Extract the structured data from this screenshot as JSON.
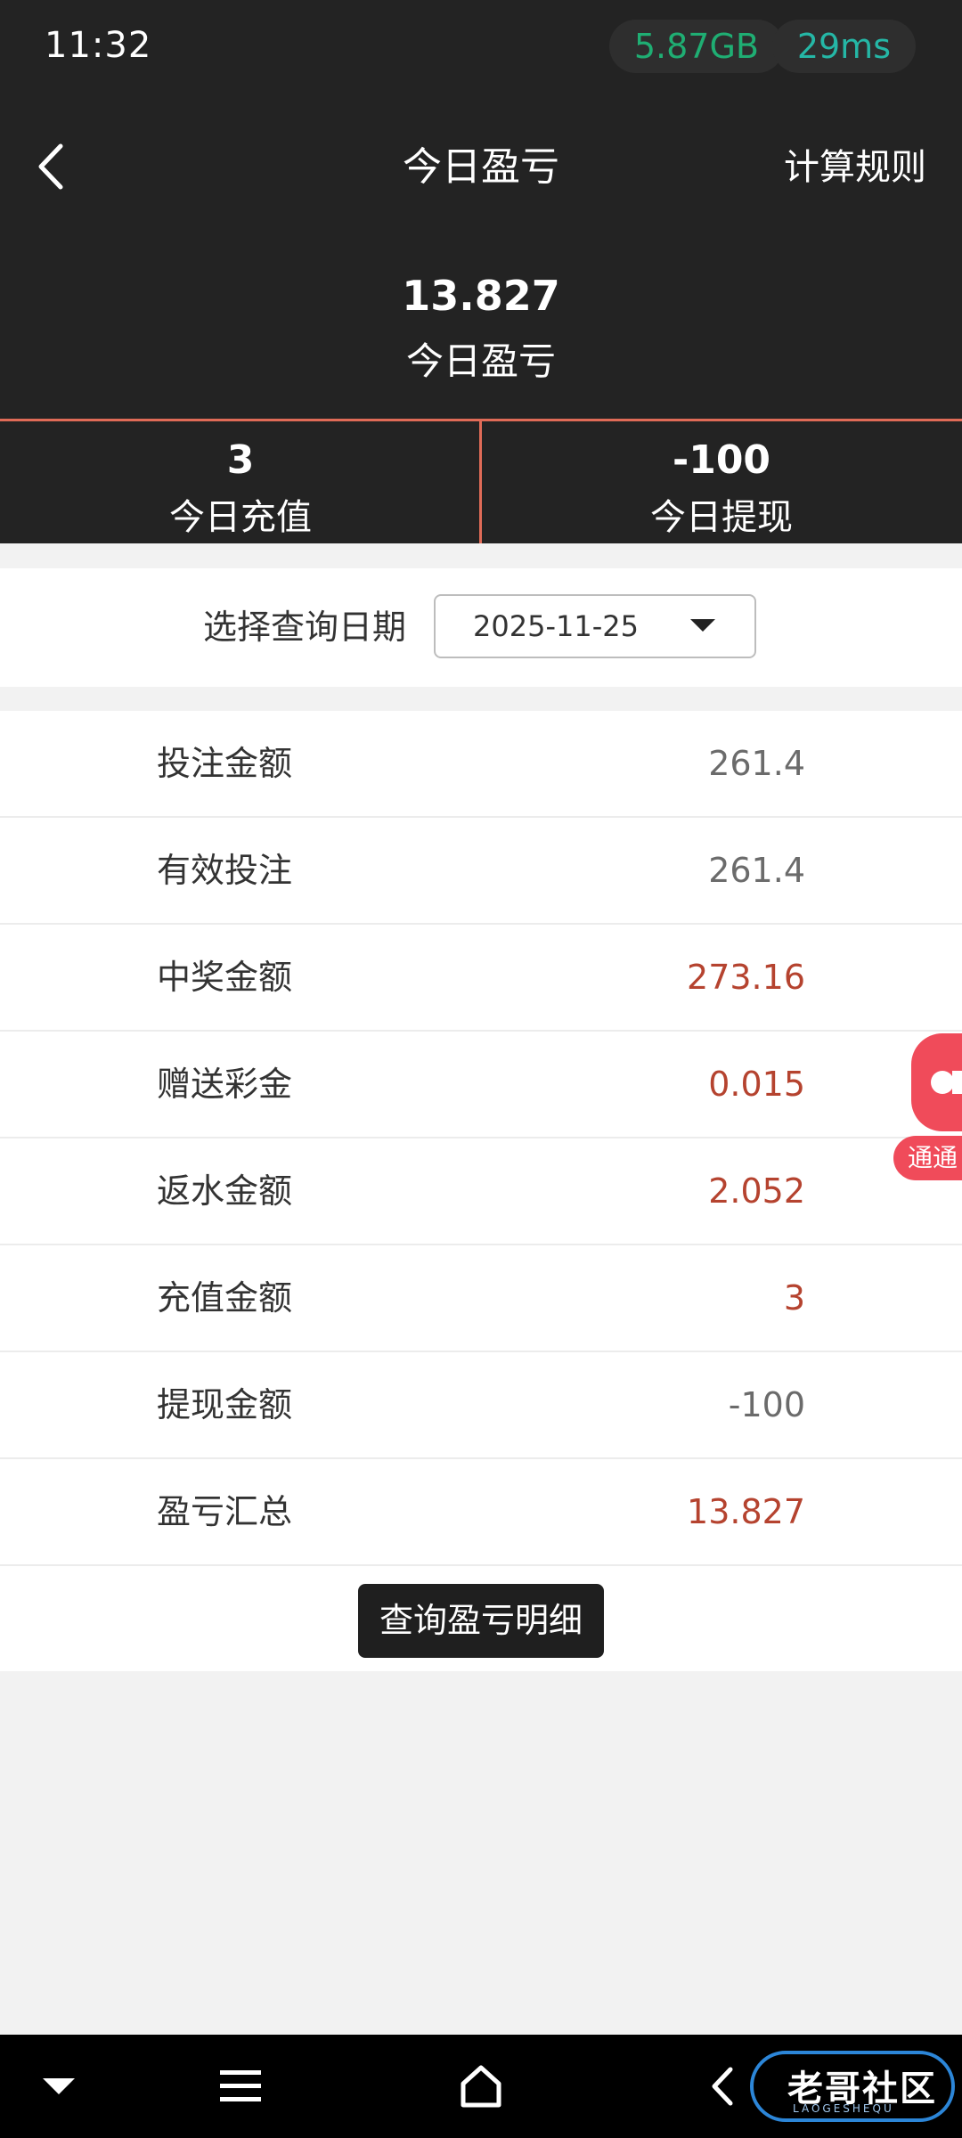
{
  "status_bar": {
    "time": "11:32",
    "memory": "5.87GB",
    "ping": "29ms"
  },
  "header": {
    "title": "今日盈亏",
    "rules_button": "计算规则",
    "back_icon": "chevron-left-icon"
  },
  "summary": {
    "value": "13.827",
    "label": "今日盈亏"
  },
  "stats": [
    {
      "value": "3",
      "label": "今日充值"
    },
    {
      "value": "-100",
      "label": "今日提现"
    }
  ],
  "date_picker": {
    "label": "选择查询日期",
    "value": "2025-11-25"
  },
  "rows": [
    {
      "label": "投注金额",
      "value": "261.4",
      "color": "#6b6b6b"
    },
    {
      "label": "有效投注",
      "value": "261.4",
      "color": "#6b6b6b"
    },
    {
      "label": "中奖金额",
      "value": "273.16",
      "color": "#b5432f"
    },
    {
      "label": "赠送彩金",
      "value": "0.015",
      "color": "#b5432f"
    },
    {
      "label": "返水金额",
      "value": "2.052",
      "color": "#b5432f"
    },
    {
      "label": "充值金额",
      "value": "3",
      "color": "#b5432f"
    },
    {
      "label": "提现金额",
      "value": "-100",
      "color": "#6b6b6b"
    },
    {
      "label": "盈亏汇总",
      "value": "13.827",
      "color": "#b5432f"
    }
  ],
  "detail_button": "查询盈亏明细",
  "floating_widget": {
    "label": "通通"
  },
  "watermark": {
    "text": "老哥社区",
    "sub": "LAOGESHEQU"
  },
  "colors": {
    "header_bg": "#232323",
    "accent_red": "#e06b57",
    "value_red": "#b5432f",
    "value_gray": "#6b6b6b"
  }
}
